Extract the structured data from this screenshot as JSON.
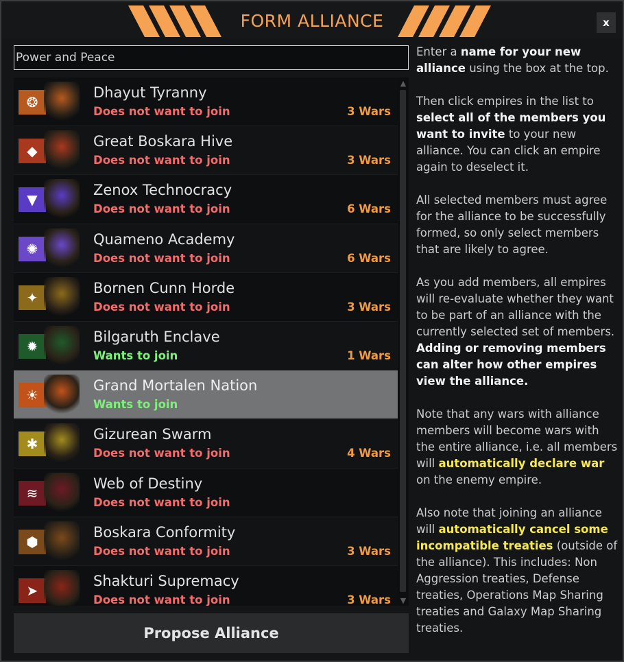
{
  "window": {
    "title": "FORM ALLIANCE",
    "close_label": "x",
    "accent_color": "#f5a253"
  },
  "alliance_name": {
    "value": "Power and Peace"
  },
  "empires": [
    {
      "name": "Dhayut Tyranny",
      "status": "Does not want to join",
      "wars": "3 Wars",
      "flag_color": "#b65a1f",
      "flag_icon": "orange-flame-emblem",
      "portrait": "insectoid-portrait"
    },
    {
      "name": "Great Boskara Hive",
      "status": "Does not want to join",
      "wars": "3 Wars",
      "flag_color": "#a8381e",
      "flag_icon": "red-chevron-emblem",
      "portrait": "green-insectoid-portrait"
    },
    {
      "name": "Zenox Technocracy",
      "status": "Does not want to join",
      "wars": "6 Wars",
      "flag_color": "#5a3cc4",
      "flag_icon": "purple-triangle-emblem",
      "portrait": "horned-alien-portrait"
    },
    {
      "name": "Quameno Academy",
      "status": "Does not want to join",
      "wars": "6 Wars",
      "flag_color": "#6a48c8",
      "flag_icon": "blue-star-emblem",
      "portrait": "quameno-portrait"
    },
    {
      "name": "Bornen Cunn Horde",
      "status": "Does not want to join",
      "wars": "3 Wars",
      "flag_color": "#8c6a1c",
      "flag_icon": "gold-claw-emblem",
      "portrait": "gold-reptile-portrait"
    },
    {
      "name": "Bilgaruth Enclave",
      "status": "Wants to join",
      "wars": "1 Wars",
      "flag_color": "#1f5a2a",
      "flag_icon": "green-sun-emblem",
      "portrait": "green-alien-portrait"
    },
    {
      "name": "Grand Mortalen Nation",
      "status": "Wants to join",
      "wars": "",
      "flag_color": "#c0521a",
      "flag_icon": "white-sun-emblem",
      "portrait": "mortalen-portrait"
    },
    {
      "name": "Gizurean Swarm",
      "status": "Does not want to join",
      "wars": "4 Wars",
      "flag_color": "#a38b1e",
      "flag_icon": "gold-bug-emblem",
      "portrait": "gizurean-portrait"
    },
    {
      "name": "Web of Destiny",
      "status": "Does not want to join",
      "wars": "",
      "flag_color": "#6e1a24",
      "flag_icon": "red-wave-emblem",
      "portrait": "pirate-portrait"
    },
    {
      "name": "Boskara Conformity",
      "status": "Does not want to join",
      "wars": "3 Wars",
      "flag_color": "#7a4a1a",
      "flag_icon": "orange-hive-emblem",
      "portrait": "boskara-portrait"
    },
    {
      "name": "Shakturi Supremacy",
      "status": "Does not want to join",
      "wars": "3 Wars",
      "flag_color": "#8a2418",
      "flag_icon": "red-arrow-emblem",
      "portrait": "red-shakturi-portrait"
    }
  ],
  "selected_index": 6,
  "propose_button": {
    "label": "Propose Alliance"
  },
  "help": {
    "p1_a": "Enter a ",
    "p1_b": "name for your new alliance",
    "p1_c": " using the box at the top.",
    "p2_a": "Then click empires in the list to ",
    "p2_b": "select all of the members you want to invite",
    "p2_c": " to your new alliance. You can click an empire again to deselect it.",
    "p3": "All selected members must agree for the alliance to be successfully formed, so only select members that are likely to agree.",
    "p4_a": "As you add members, all empires will re-evaluate whether they want to be part of an alliance with the currently selected set of members. ",
    "p4_b": "Adding or removing members can alter how other empires view the alliance.",
    "p5_a": "Note that any wars with alliance members will become wars with the entire alliance, i.e. all members will ",
    "p5_b": "automatically declare war",
    "p5_c": " on the enemy empire.",
    "p6_a": "Also note that joining an alliance will ",
    "p6_b": "automatically cancel some incompatible treaties",
    "p6_c": " (outside of the alliance). This includes: Non Aggression treaties, Defense treaties, Operations Map Sharing treaties and Galaxy Map Sharing treaties."
  }
}
